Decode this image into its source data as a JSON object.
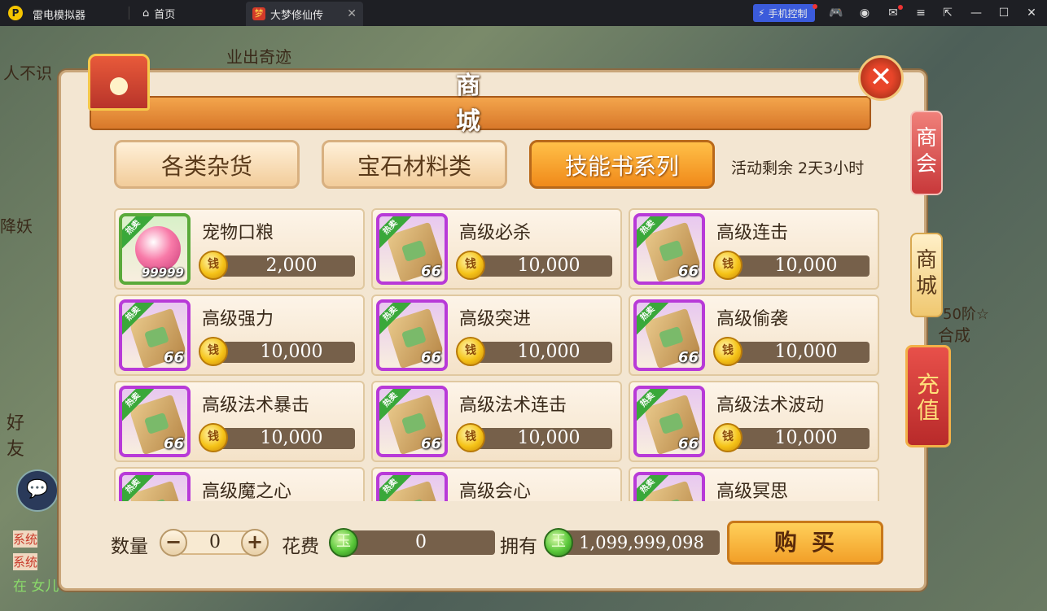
{
  "emulator": {
    "app_name": "雷电模拟器",
    "home_tab": "首页",
    "game_tab": "大梦修仙传",
    "phone_control": "手机控制",
    "icons": [
      "gamepad-icon",
      "user-icon",
      "mail-icon",
      "menu-icon",
      "export-icon",
      "minimize-icon",
      "maximize-icon",
      "close-icon"
    ]
  },
  "background": {
    "texts": [
      "业出奇迹",
      "人不识",
      "降妖",
      "好友",
      "50阶☆",
      "合成",
      "系统",
      "系统",
      "在 女儿"
    ]
  },
  "shop": {
    "title": "商 城",
    "close_symbol": "✕",
    "tabs": [
      {
        "label": "各类杂货",
        "active": false
      },
      {
        "label": "宝石材料类",
        "active": false
      },
      {
        "label": "技能书系列",
        "active": true
      }
    ],
    "activity_text": "活动剩余 2天3小时",
    "side_tabs": {
      "shanghui": "商会",
      "shangcheng": "商城",
      "chongzhi": "充值"
    },
    "hot_badge": "热卖",
    "coin_symbol": "钱",
    "items": [
      {
        "name": "宠物口粮",
        "qty": "99999",
        "price": "2,000",
        "frame": "green",
        "icon": "pet-food-orb-icon"
      },
      {
        "name": "高级必杀",
        "qty": "66",
        "price": "10,000",
        "frame": "purple",
        "icon": "skill-scroll-icon"
      },
      {
        "name": "高级连击",
        "qty": "66",
        "price": "10,000",
        "frame": "purple",
        "icon": "skill-scroll-icon"
      },
      {
        "name": "高级强力",
        "qty": "66",
        "price": "10,000",
        "frame": "purple",
        "icon": "skill-scroll-icon"
      },
      {
        "name": "高级突进",
        "qty": "66",
        "price": "10,000",
        "frame": "purple",
        "icon": "skill-scroll-icon"
      },
      {
        "name": "高级偷袭",
        "qty": "66",
        "price": "10,000",
        "frame": "purple",
        "icon": "skill-scroll-icon"
      },
      {
        "name": "高级法术暴击",
        "qty": "66",
        "price": "10,000",
        "frame": "purple",
        "icon": "skill-scroll-icon"
      },
      {
        "name": "高级法术连击",
        "qty": "66",
        "price": "10,000",
        "frame": "purple",
        "icon": "skill-scroll-icon"
      },
      {
        "name": "高级法术波动",
        "qty": "66",
        "price": "10,000",
        "frame": "purple",
        "icon": "skill-scroll-icon"
      },
      {
        "name": "高级魔之心",
        "qty": "",
        "price": "",
        "frame": "purple",
        "icon": "skill-scroll-icon"
      },
      {
        "name": "高级会心",
        "qty": "",
        "price": "",
        "frame": "purple",
        "icon": "skill-scroll-icon"
      },
      {
        "name": "高级冥思",
        "qty": "",
        "price": "",
        "frame": "purple",
        "icon": "skill-scroll-icon"
      }
    ],
    "bottom": {
      "quantity_label": "数量",
      "minus": "−",
      "plus": "+",
      "quantity_value": "0",
      "cost_label": "花费",
      "cost_value": "0",
      "owned_label": "拥有",
      "owned_value": "1,099,999,098",
      "jade_symbol": "玉",
      "buy_label": "购买"
    }
  }
}
